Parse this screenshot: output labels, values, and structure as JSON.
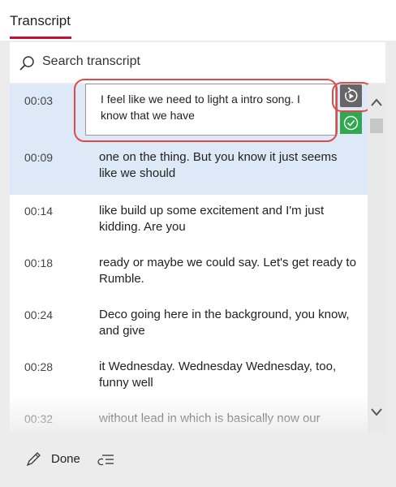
{
  "header": {
    "tab_label": "Transcript"
  },
  "search": {
    "placeholder": "Search transcript"
  },
  "editing": {
    "time": "00:03",
    "text": "I feel like we need to light a intro song. I know that we have"
  },
  "rows": [
    {
      "time": "00:09",
      "text": "one on the thing. But you know it just seems like we should"
    },
    {
      "time": "00:14",
      "text": "like build up some excitement and I'm just kidding. Are you"
    },
    {
      "time": "00:18",
      "text": "ready or maybe we could say. Let's get ready to Rumble."
    },
    {
      "time": "00:24",
      "text": "Deco going here in the background, you know, and give"
    },
    {
      "time": "00:28",
      "text": "it Wednesday. Wednesday Wednesday, too, funny well"
    },
    {
      "time": "00:32",
      "text": "without lead in which is basically now our"
    }
  ],
  "footer": {
    "done_label": "Done"
  },
  "colors": {
    "accent": "#c4123b",
    "confirm": "#2fa84f",
    "selected_row": "#dde9f6",
    "annotation": "#e04a4a"
  },
  "icons": [
    "search-icon",
    "replay-icon",
    "check-icon",
    "chevron-up-icon",
    "chevron-down-icon",
    "pencil-icon",
    "format-lines-icon"
  ]
}
